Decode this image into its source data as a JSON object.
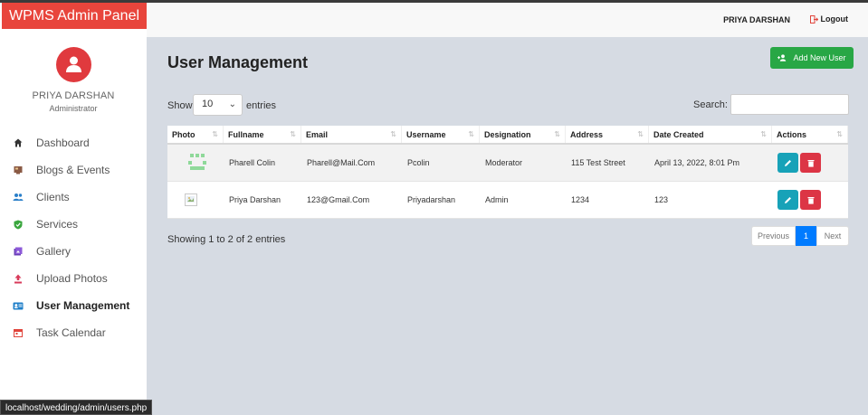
{
  "app": {
    "brand": "WPMS Admin Panel"
  },
  "sidebar": {
    "profile": {
      "name": "PRIYA DARSHAN",
      "role": "Administrator"
    },
    "items": [
      {
        "label": "Dashboard",
        "icon": "home-icon",
        "active": false
      },
      {
        "label": "Blogs & Events",
        "icon": "blog-icon",
        "active": false
      },
      {
        "label": "Clients",
        "icon": "users-icon",
        "active": false
      },
      {
        "label": "Services",
        "icon": "shield-check-icon",
        "active": false
      },
      {
        "label": "Gallery",
        "icon": "gallery-icon",
        "active": false
      },
      {
        "label": "Upload Photos",
        "icon": "upload-icon",
        "active": false
      },
      {
        "label": "User Management",
        "icon": "id-card-icon",
        "active": true
      },
      {
        "label": "Task Calendar",
        "icon": "calendar-icon",
        "active": false
      }
    ]
  },
  "header": {
    "user": "PRIYA DARSHAN",
    "logout": "Logout"
  },
  "main": {
    "title": "User Management",
    "add_button": "Add New User",
    "show_label": "Show",
    "entries_value": "10",
    "entries_label": "entries",
    "search_label": "Search:",
    "search_value": ""
  },
  "table": {
    "columns": [
      "Photo",
      "Fullname",
      "Email",
      "Username",
      "Designation",
      "Address",
      "Date Created",
      "Actions"
    ],
    "rows": [
      {
        "fullname": "Pharell Colin",
        "email": "Pharell@Mail.Com",
        "username": "Pcolin",
        "designation": "Moderator",
        "address": "115 Test Street",
        "date_created": "April 13, 2022, 8:01 Pm"
      },
      {
        "fullname": "Priya Darshan",
        "email": "123@Gmail.Com",
        "username": "Priyadarshan",
        "designation": "Admin",
        "address": "1234",
        "date_created": "123"
      }
    ]
  },
  "footer": {
    "showing": "Showing 1 to 2 of 2 entries",
    "previous": "Previous",
    "current_page": "1",
    "next": "Next"
  },
  "statusbar": {
    "url": "localhost/wedding/admin/users.php"
  },
  "colors": {
    "brand": "#e8453c",
    "add": "#28a745",
    "edit": "#17a2b8",
    "delete": "#dc3545",
    "page": "#007bff"
  }
}
